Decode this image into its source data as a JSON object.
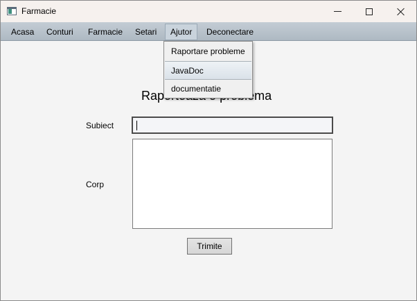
{
  "window": {
    "title": "Farmacie"
  },
  "menubar": {
    "items": [
      {
        "label": "Acasa"
      },
      {
        "label": "Conturi"
      },
      {
        "label": "Farmacie"
      },
      {
        "label": "Setari"
      },
      {
        "label": "Ajutor"
      },
      {
        "label": "Deconectare"
      }
    ]
  },
  "dropdown": {
    "items": [
      {
        "label": "Raportare probleme"
      },
      {
        "label": "JavaDoc"
      },
      {
        "label": "documentatie"
      }
    ]
  },
  "form": {
    "title": "Raporteaza o problema",
    "subject_label": "Subiect",
    "subject_value": "",
    "body_label": "Corp",
    "body_value": "",
    "submit_label": "Trimite"
  }
}
